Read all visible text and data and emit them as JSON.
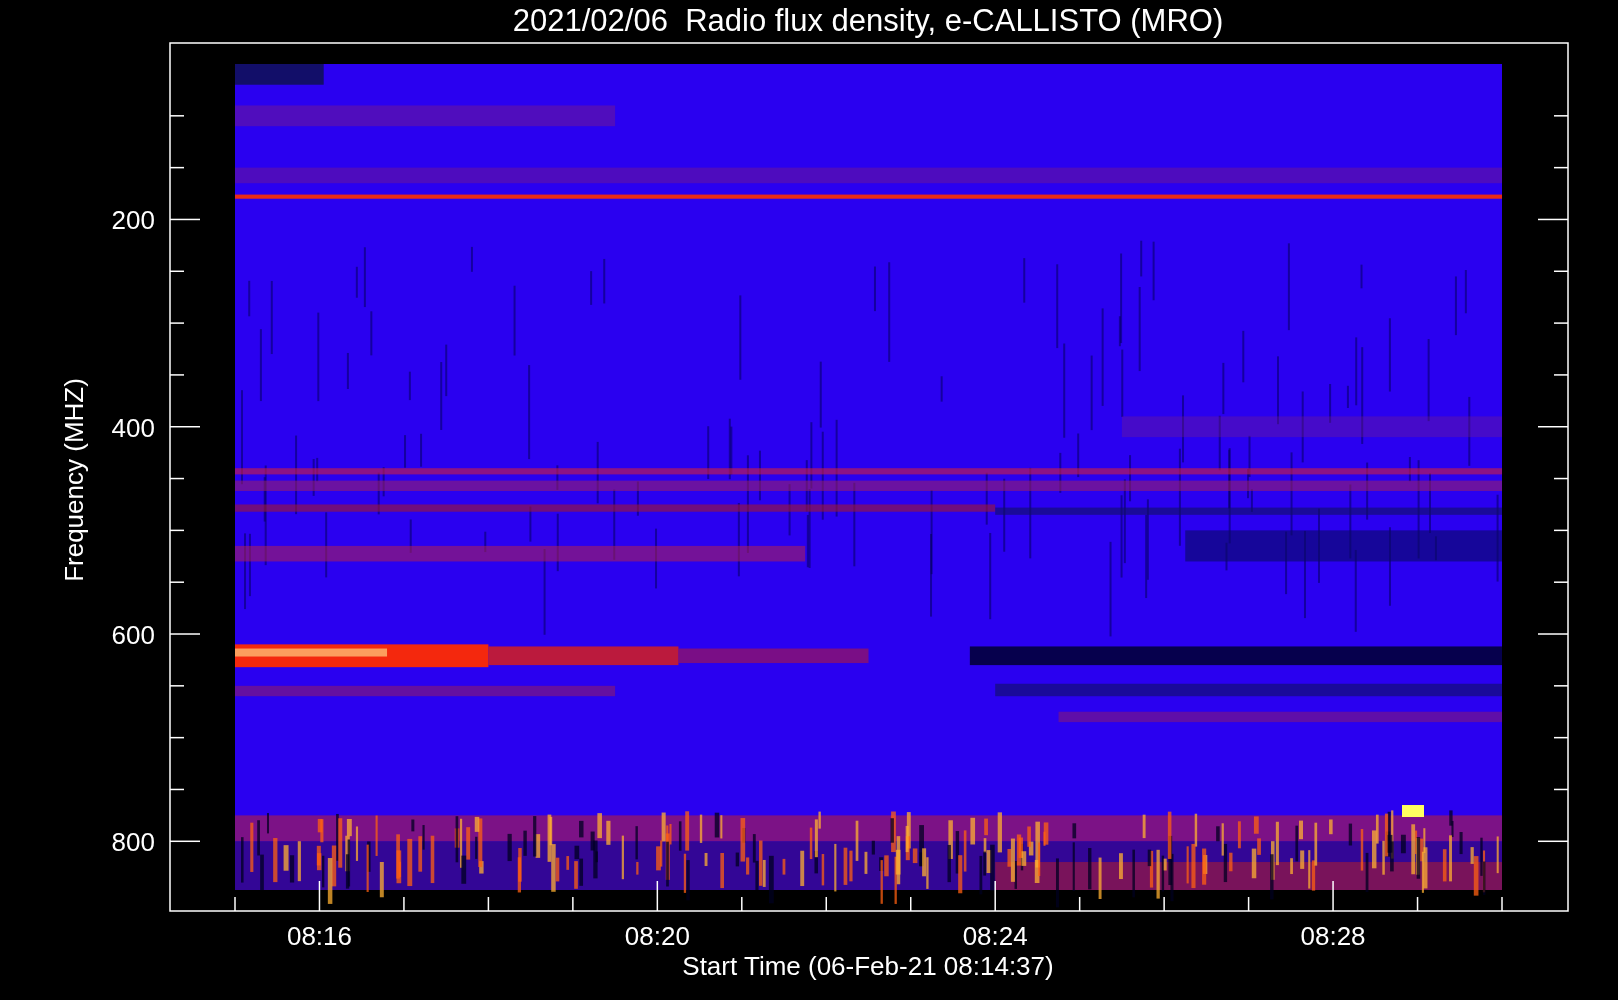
{
  "title": "2021/02/06  Radio flux density, e-CALLISTO (MRO)",
  "plot": {
    "xlabel": "Start Time (06-Feb-21 08:14:37)",
    "ylabel": "Frequency (MHZ)",
    "xticks": [
      "08:16",
      "08:20",
      "08:24",
      "08:28"
    ],
    "yticks": [
      "200",
      "400",
      "600",
      "800"
    ]
  }
}
